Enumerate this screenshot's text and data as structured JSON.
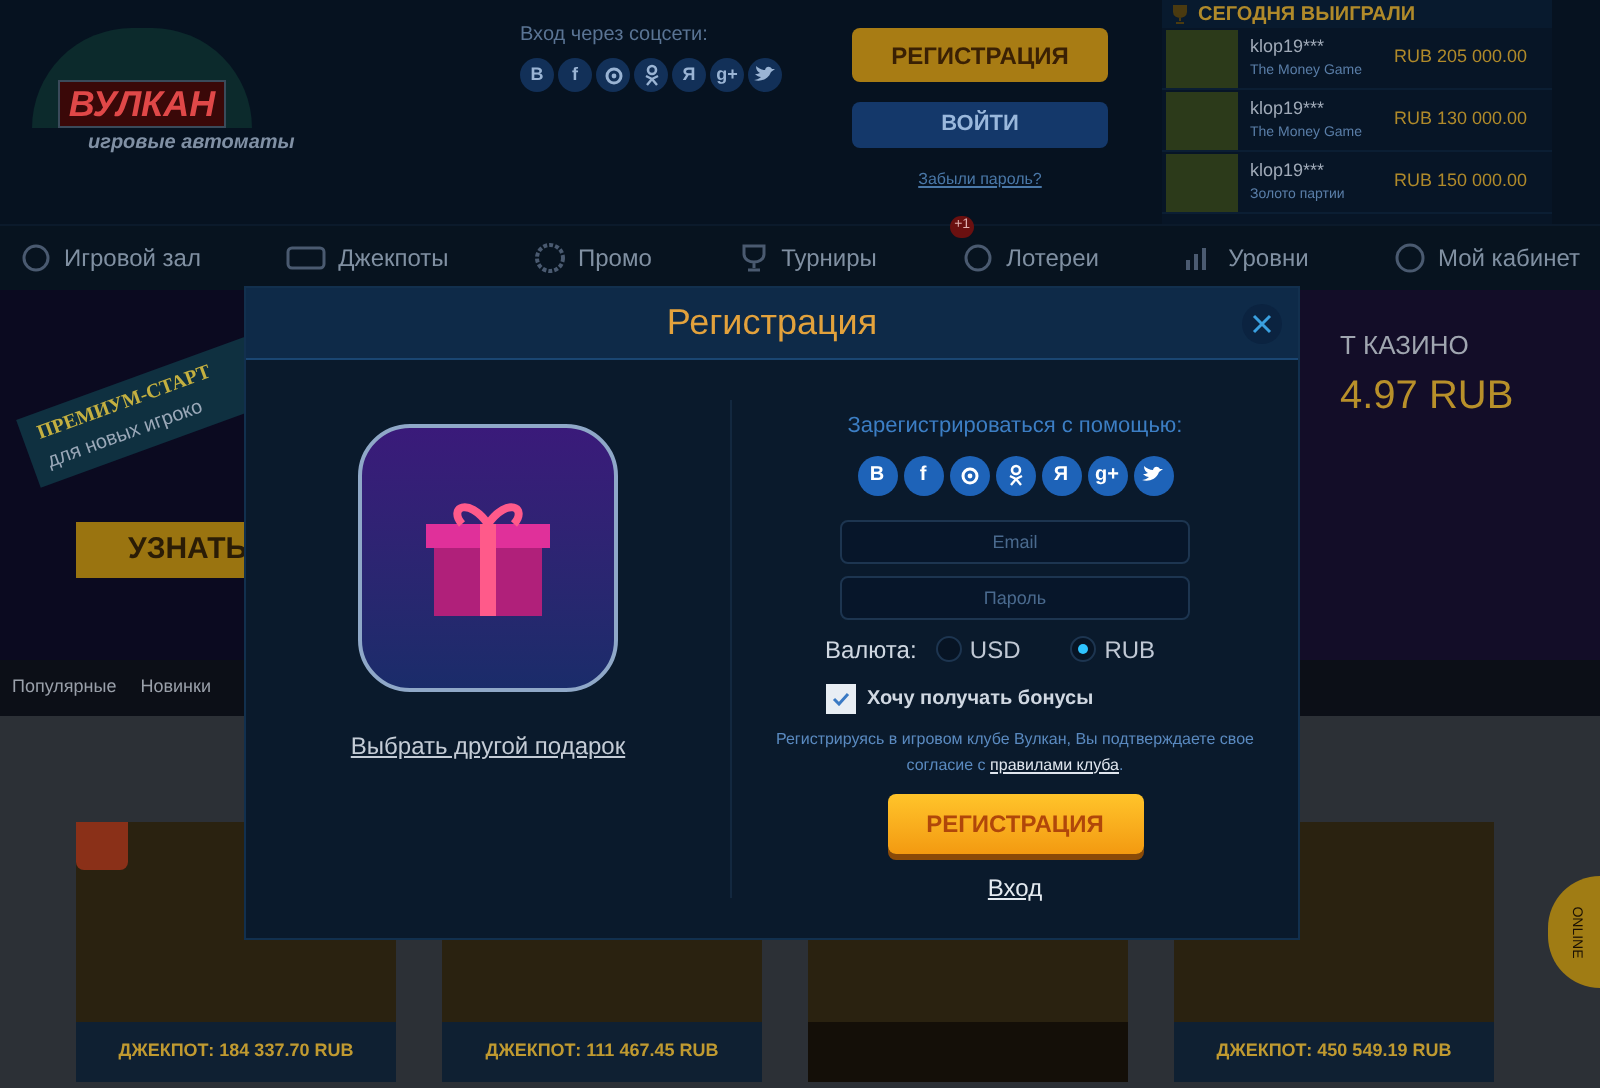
{
  "header": {
    "logo": {
      "title": "ВУЛКАН",
      "subtitle": "игровые автоматы"
    },
    "social_login": {
      "label": "Вход через соцсети:",
      "networks": [
        {
          "kind": "vk",
          "label": "B"
        },
        {
          "kind": "facebook",
          "label": "f"
        },
        {
          "kind": "mail"
        },
        {
          "kind": "ok"
        },
        {
          "kind": "yandex",
          "label": "Я"
        },
        {
          "kind": "google",
          "label": "g+"
        },
        {
          "kind": "twitter"
        }
      ]
    },
    "register_button": "РЕГИСТРАЦИЯ",
    "login_button": "ВОЙТИ",
    "forgot_link": "Забыли пароль?"
  },
  "winners": {
    "title": "СЕГОДНЯ ВЫИГРАЛИ",
    "rows": [
      {
        "player": "klop19***",
        "game": "The Money Game",
        "amount": "RUB 205 000.00"
      },
      {
        "player": "klop19***",
        "game": "The Money Game",
        "amount": "RUB 130 000.00"
      },
      {
        "player": "klop19***",
        "game": "Золото партии",
        "amount": "RUB 150 000.00"
      }
    ]
  },
  "nav": [
    {
      "kind": "hall",
      "label": "Игровой зал"
    },
    {
      "kind": "jackpots",
      "label": "Джекпоты"
    },
    {
      "kind": "promo",
      "label": "Промо"
    },
    {
      "kind": "tournaments",
      "label": "Турниры"
    },
    {
      "kind": "lotteries",
      "label": "Лотереи",
      "badge": "+1"
    },
    {
      "kind": "levels",
      "label": "Уровни"
    },
    {
      "kind": "account",
      "label": "Мой кабинет"
    }
  ],
  "promo": {
    "ribbon_title": "ПРЕМИУМ-СТАРТ",
    "ribbon_subtitle": "для новых игроко",
    "button": "УЗНАТЬ"
  },
  "jackpot_banner": {
    "title": "Т КАЗИНО",
    "amount": "4.97 RUB"
  },
  "game_tabs": [
    "Популярные",
    "Новинки"
  ],
  "games": [
    {
      "kind": "jackpot",
      "hot": true,
      "jackpot": "ДЖЕКПОТ: 184 337.70 RUB"
    },
    {
      "kind": "jackpot",
      "jackpot": "ДЖЕКПОТ: 111 467.45 RUB"
    },
    {
      "kind": "plain"
    },
    {
      "kind": "jackpot",
      "jackpot": "ДЖЕКПОТ: 450 549.19 RUB"
    }
  ],
  "online_tab": "ONLINE",
  "modal": {
    "title": "Регистрация",
    "gift_link": "Выбрать другой подарок",
    "social_label": "Зарегистрироваться с помощью:",
    "networks": [
      {
        "kind": "vk",
        "label": "B"
      },
      {
        "kind": "facebook",
        "label": "f"
      },
      {
        "kind": "mail"
      },
      {
        "kind": "ok"
      },
      {
        "kind": "yandex",
        "label": "Я"
      },
      {
        "kind": "google",
        "label": "g+"
      },
      {
        "kind": "twitter"
      }
    ],
    "email_placeholder": "Email",
    "password_placeholder": "Пароль",
    "currency_label": "Валюта:",
    "currencies": [
      {
        "label": "USD",
        "selected": false
      },
      {
        "label": "RUB",
        "selected": true
      }
    ],
    "bonus_checkbox": {
      "label": "Хочу получать бонусы",
      "checked": true
    },
    "terms_text": "Регистрируясь в игровом клубе Вулкан, Вы подтверждаете свое согласие с",
    "terms_link": "правилами клуба",
    "terms_end": ".",
    "register_button": "РЕГИСТРАЦИЯ",
    "login_link": "Вход"
  }
}
